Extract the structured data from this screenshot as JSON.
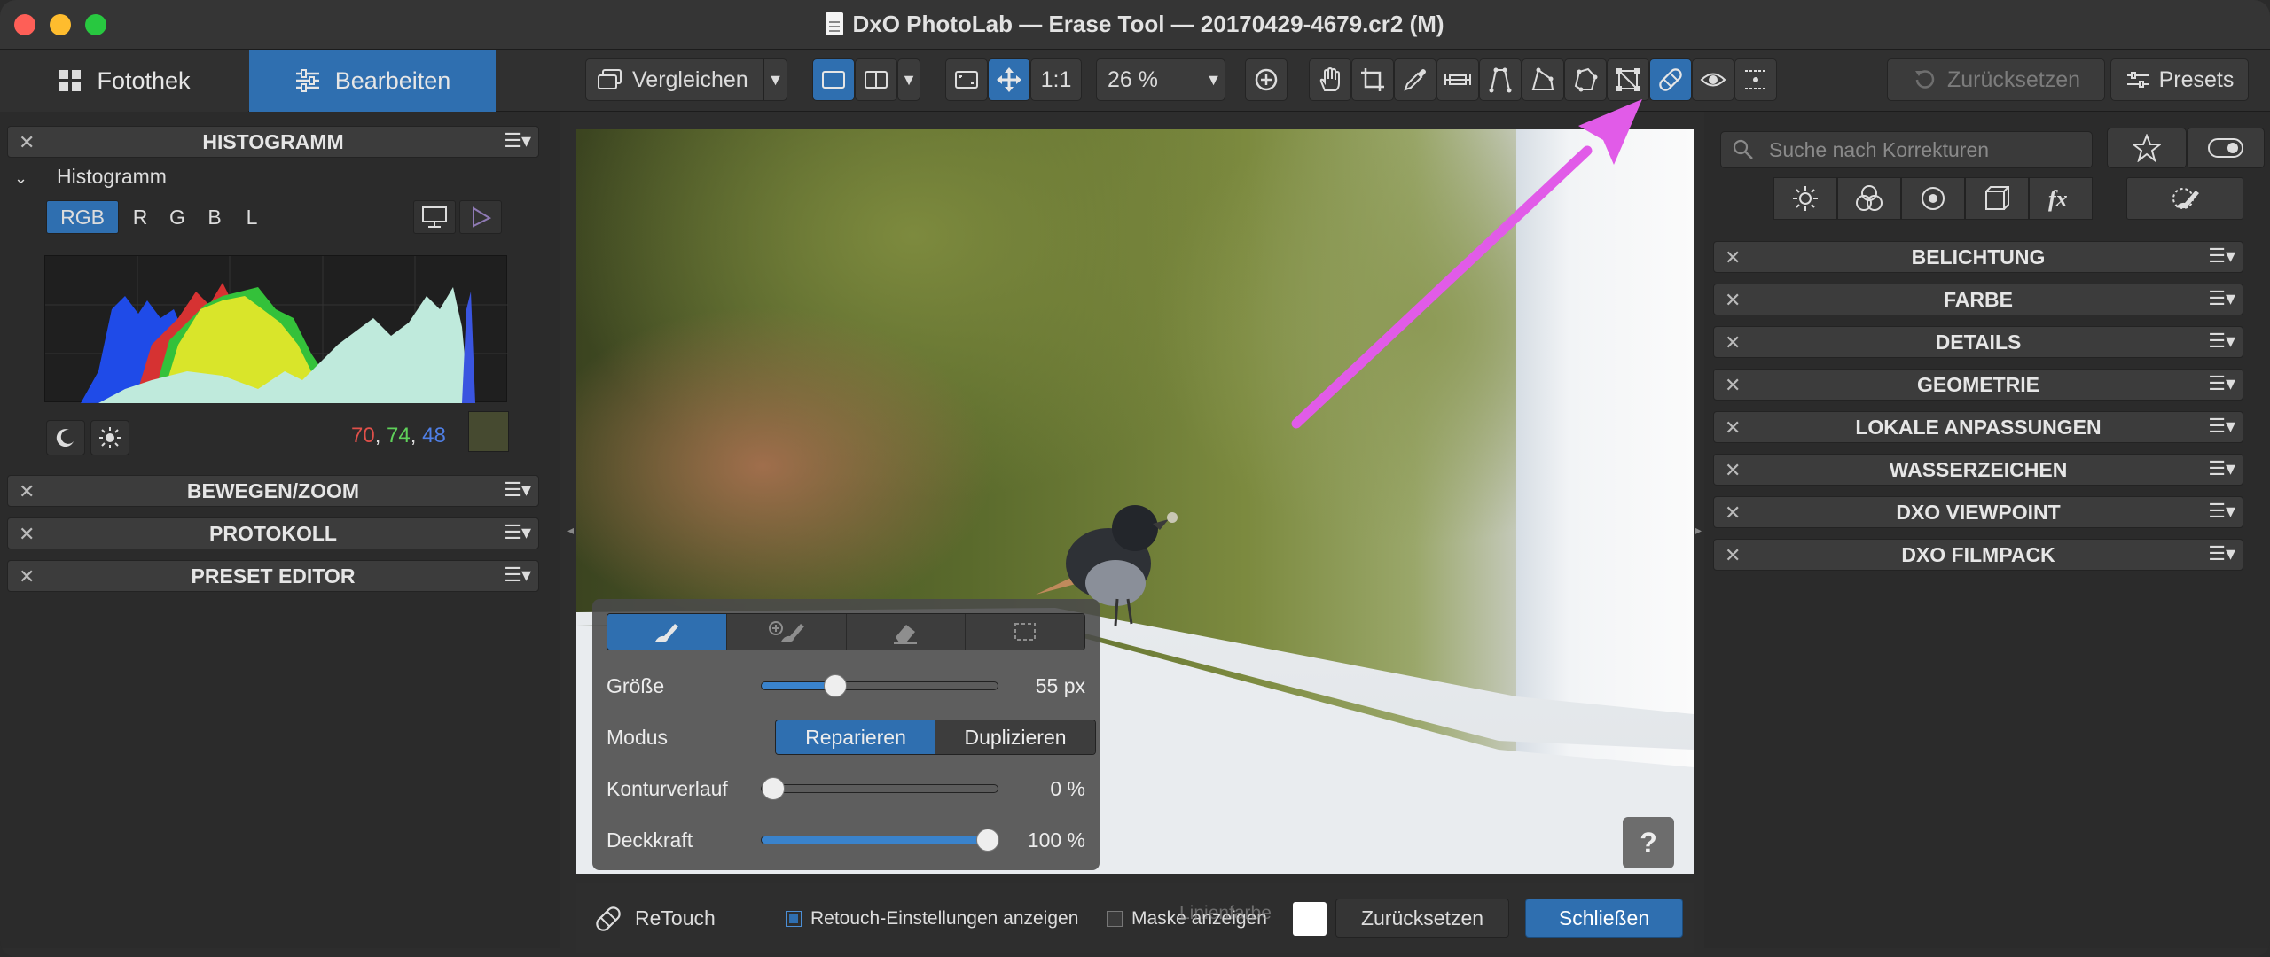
{
  "window": {
    "title": "DxO PhotoLab — Erase Tool — 20170429-4679.cr2 (M)"
  },
  "tabs": {
    "library": "Fotothek",
    "edit": "Bearbeiten"
  },
  "toolbar": {
    "compare": "Vergleichen",
    "one_to_one": "1:1",
    "zoom": "26 %",
    "reset": "Zurücksetzen",
    "presets": "Presets"
  },
  "left_panel": {
    "histogram_header": "HISTOGRAMM",
    "histogram_sub": "Histogramm",
    "channels": [
      "RGB",
      "R",
      "G",
      "B",
      "L"
    ],
    "rgb_values": {
      "r": "70",
      "g": "74",
      "b": "48",
      "sep": ", "
    },
    "sections": [
      "BEWEGEN/ZOOM",
      "PROTOKOLL",
      "PRESET EDITOR"
    ]
  },
  "right_panel": {
    "search_placeholder": "Suche nach Korrekturen",
    "sections": [
      "BELICHTUNG",
      "FARBE",
      "DETAILS",
      "GEOMETRIE",
      "LOKALE ANPASSUNGEN",
      "WASSERZEICHEN",
      "DXO VIEWPOINT",
      "DXO FILMPACK"
    ]
  },
  "erase_panel": {
    "size_label": "Größe",
    "size_value": "55 px",
    "size_fraction": 0.29,
    "mode_label": "Modus",
    "mode_repair": "Reparieren",
    "mode_duplicate": "Duplizieren",
    "feather_label": "Konturverlauf",
    "feather_value": "0 %",
    "feather_fraction": 0.0,
    "opacity_label": "Deckkraft",
    "opacity_value": "100 %",
    "opacity_fraction": 1.0
  },
  "help": "?",
  "bottombar": {
    "retouch": "ReTouch",
    "show_settings": "Retouch-Einstellungen anzeigen",
    "show_mask": "Maske anzeigen",
    "overlap_text": "Linienfarbe",
    "reset": "Zurücksetzen",
    "close": "Schließen"
  },
  "colors": {
    "accent": "#2f6fb0",
    "annotation_arrow": "#e15be8",
    "rgb_r": "#e0504a",
    "rgb_g": "#5fd05a",
    "rgb_b": "#4f7fe6"
  }
}
